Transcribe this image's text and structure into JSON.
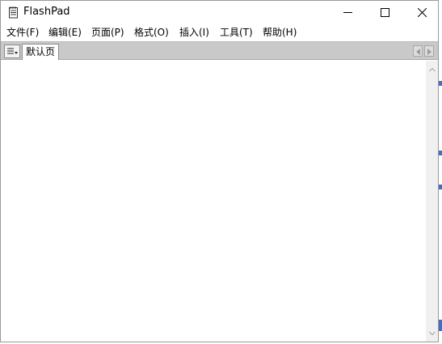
{
  "window": {
    "title": "FlashPad",
    "app_icon": "notepad-icon",
    "controls": [
      "minimize-icon",
      "maximize-icon",
      "close-icon"
    ]
  },
  "menu": {
    "file": "文件(F)",
    "edit": "编辑(E)",
    "page": "页面(P)",
    "format": "格式(O)",
    "insert": "插入(I)",
    "tools": "工具(T)",
    "help": "帮助(H)"
  },
  "tabs": {
    "menu_icon": "list-menu-icon",
    "items": [
      {
        "label": "默认页",
        "active": true
      }
    ],
    "scroll_left_icon": "triangle-left-icon",
    "scroll_right_icon": "triangle-right-icon"
  },
  "editor": {
    "content": ""
  },
  "colors": {
    "tabstrip_bg": "#c9c9c9",
    "scrollbar_bg": "#f0f0f0",
    "border": "#8a8a8a"
  }
}
